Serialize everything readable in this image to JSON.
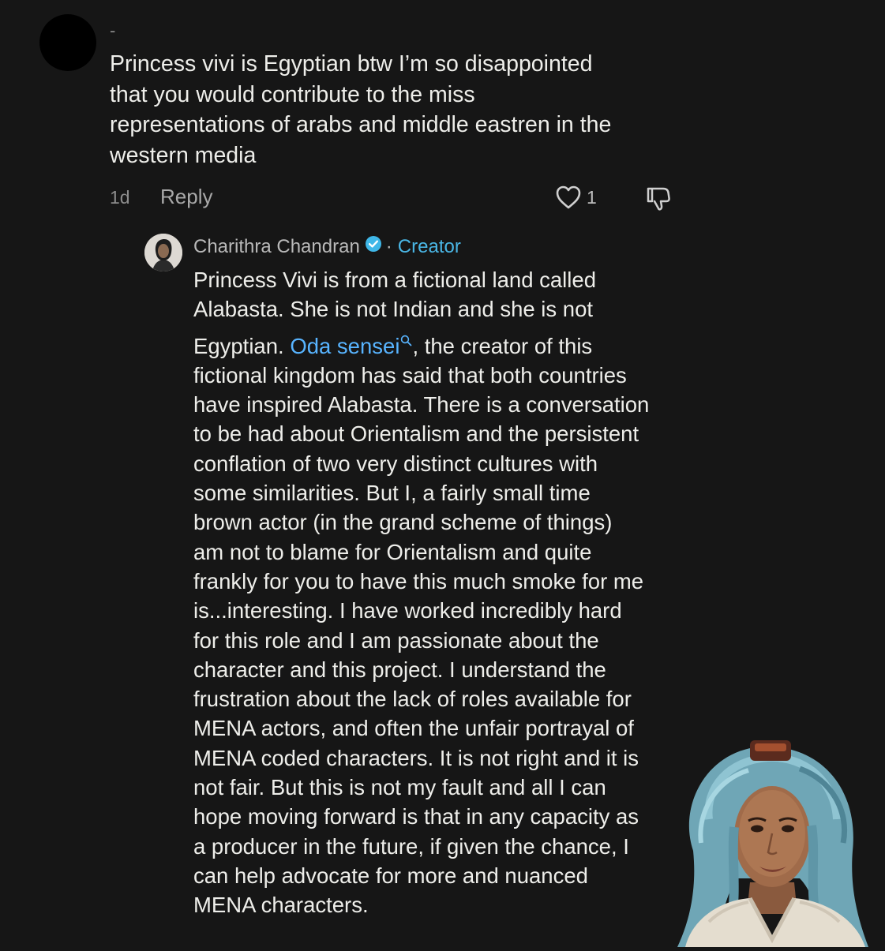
{
  "comment": {
    "username": "-",
    "lines": [
      "Princess vivi is Egyptian btw I’m so disappointed",
      "that you would contribute to the miss",
      "representations of arabs and middle eastren in the",
      "western media"
    ],
    "time": "1d",
    "reply_label": "Reply",
    "like_count": "1"
  },
  "reply": {
    "author": "Charithra Chandran",
    "separator": "·",
    "badge": "Creator",
    "line1": "Princess Vivi is from a fictional land called",
    "line2": "Alabasta. She is not Indian and she is not",
    "line3_prefix": "Egyptian. ",
    "link_text": "Oda sensei",
    "line3_suffix": ", the creator of this",
    "lines_rest": [
      "fictional kingdom has said that both countries",
      "have inspired Alabasta. There is a conversation",
      "to be had about Orientalism and the persistent",
      "conflation of two very distinct cultures with",
      "some similarities. But I, a fairly small time",
      "brown actor (in the grand scheme of things)",
      "am not to blame for Orientalism and quite",
      "frankly for you to have this much smoke for me",
      "is...interesting. I have worked incredibly hard",
      "for this role and I am passionate about the",
      "character and this project. I understand the",
      "frustration about the lack of roles available for",
      "MENA actors, and often the unfair portrayal of",
      "MENA coded characters. It is not right and it is",
      "not fair. But this is not my fault and all I can",
      "hope moving forward is that in any capacity as",
      "a producer in the future, if given the chance, I",
      "can help advocate for more and nuanced",
      "MENA characters."
    ]
  },
  "colors": {
    "background": "#161616",
    "text": "#eeeeea",
    "muted": "#8c8c8c",
    "creator": "#4ab7e6",
    "link": "#58b4ff"
  },
  "icons": [
    "heart-icon",
    "dislike-icon",
    "verified-icon",
    "search-icon"
  ]
}
